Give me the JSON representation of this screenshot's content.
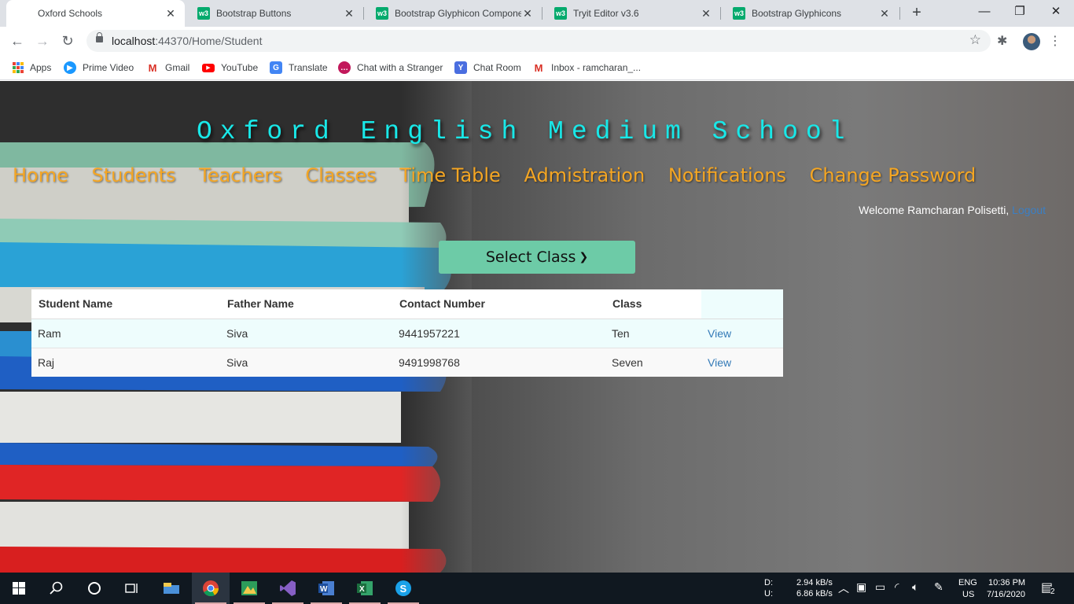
{
  "browser": {
    "tabs": [
      {
        "title": "Oxford Schools",
        "favicon": "page-icon",
        "active": true
      },
      {
        "title": "Bootstrap Buttons",
        "favicon": "w3schools-icon",
        "active": false
      },
      {
        "title": "Bootstrap Glyphicon Compone",
        "favicon": "w3schools-icon",
        "active": false
      },
      {
        "title": "Tryit Editor v3.6",
        "favicon": "w3schools-icon",
        "active": false
      },
      {
        "title": "Bootstrap Glyphicons",
        "favicon": "w3schools-icon",
        "active": false
      }
    ],
    "url_host": "localhost",
    "url_rest": ":44370/Home/Student",
    "bookmarks": [
      {
        "label": "Apps",
        "icon": "apps-grid-icon"
      },
      {
        "label": "Prime Video",
        "icon": "prime-video-icon",
        "color": "#1a98ff"
      },
      {
        "label": "Gmail",
        "icon": "gmail-icon",
        "color": "#d93025"
      },
      {
        "label": "YouTube",
        "icon": "youtube-icon",
        "color": "#ff0000"
      },
      {
        "label": "Translate",
        "icon": "translate-icon",
        "color": "#4285f4"
      },
      {
        "label": "Chat with a Stranger",
        "icon": "chat-icon",
        "color": "#c2185b"
      },
      {
        "label": "Chat Room",
        "icon": "chat-room-icon",
        "color": "#4a6ee0"
      },
      {
        "label": "Inbox - ramcharan_...",
        "icon": "gmail-icon",
        "color": "#d93025"
      }
    ]
  },
  "site": {
    "title": "Oxford English Medium School",
    "nav": [
      "Home",
      "Students",
      "Teachers",
      "Classes",
      "Time Table",
      "Admistration",
      "Notifications",
      "Change Password"
    ],
    "welcome": "Welcome Ramcharan Polisetti,",
    "logout": "Logout",
    "select_class": "Select Class",
    "colors": {
      "title": "#19e8e8",
      "nav": "#f5a623",
      "button": "#6dcba7",
      "link": "#337ab7"
    }
  },
  "table": {
    "headers": [
      "Student Name",
      "Father Name",
      "Contact Number",
      "Class",
      ""
    ],
    "rows": [
      [
        "Ram",
        "Siva",
        "9441957221",
        "Ten",
        "View"
      ],
      [
        "Raj",
        "Siva",
        "9491998768",
        "Seven",
        "View"
      ]
    ]
  },
  "taskbar": {
    "net_labels": [
      "D:",
      "U:"
    ],
    "net_down": "2.94 kB/s",
    "net_up": "6.86 kB/s",
    "lang1": "ENG",
    "lang2": "US",
    "time": "10:36 PM",
    "date": "7/16/2020",
    "notifications": "2"
  }
}
